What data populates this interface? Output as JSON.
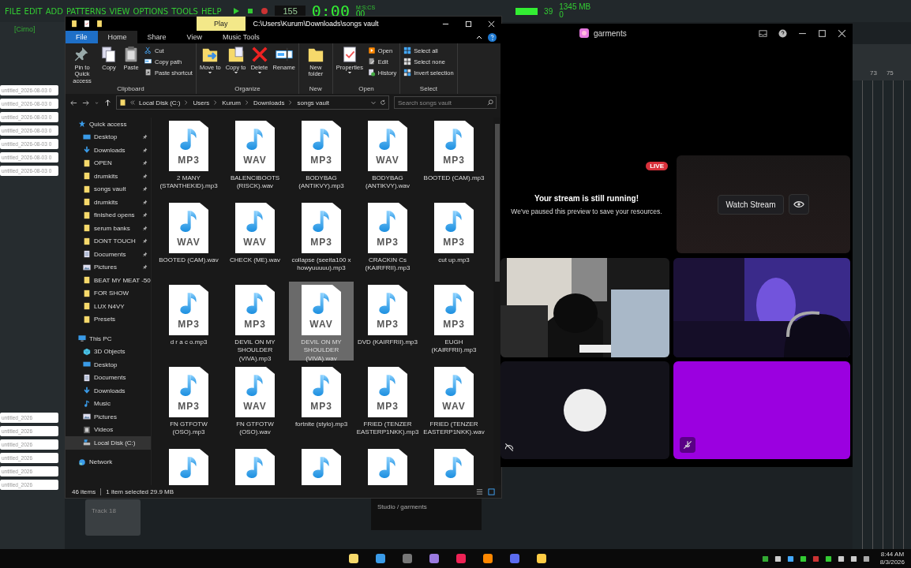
{
  "fl": {
    "menu": [
      "FILE",
      "EDIT",
      "ADD",
      "PATTERNS",
      "VIEW",
      "OPTIONS",
      "TOOLS",
      "HELP"
    ],
    "tempo": "155",
    "time": "0:00",
    "time_small": "00",
    "time_unit": "M:S:CS",
    "cpu": "39",
    "memory": "1345 MB",
    "polyphony": "0",
    "preset": "[Cirno]",
    "browser": [
      "untitled_2026-08-03 0",
      "untitled_2026-08-03 0",
      "untitled_2026-08-03 0",
      "untitled_2026-08-03 0",
      "untitled_2026-08-03 0",
      "untitled_2026-08-03 0",
      "untitled_2026-08-03 0"
    ],
    "browser_lower": [
      "untitled_2026",
      "untitled_2026",
      "untitled_2026",
      "untitled_2026",
      "untitled_2026",
      "untitled_2026"
    ],
    "track": "Track 18",
    "bars": [
      "73",
      "75"
    ]
  },
  "explorer": {
    "title": "C:\\Users\\Kurum\\Downloads\\songs vault",
    "context_tab": "Play",
    "tabs": [
      {
        "label": "File",
        "kind": "file",
        "selected": false
      },
      {
        "label": "Home",
        "kind": "tab",
        "selected": true
      },
      {
        "label": "Share",
        "kind": "tab",
        "selected": false
      },
      {
        "label": "View",
        "kind": "tab",
        "selected": false
      },
      {
        "label": "Music Tools",
        "kind": "tab",
        "selected": false
      }
    ],
    "groups": [
      {
        "name": "Clipboard",
        "large": [
          {
            "label": "Pin to Quick access",
            "kind": "pin",
            "dropdown": false
          },
          {
            "label": "Copy",
            "kind": "copy",
            "dropdown": false
          },
          {
            "label": "Paste",
            "kind": "paste",
            "dropdown": false
          }
        ],
        "small": [
          {
            "label": "Cut",
            "kind": "cut"
          },
          {
            "label": "Copy path",
            "kind": "path"
          },
          {
            "label": "Paste shortcut",
            "kind": "shortcut"
          }
        ]
      },
      {
        "name": "Organize",
        "large": [
          {
            "label": "Move to",
            "kind": "move",
            "dropdown": true
          },
          {
            "label": "Copy to",
            "kind": "copyto",
            "dropdown": true
          },
          {
            "label": "Delete",
            "kind": "delete",
            "dropdown": true
          },
          {
            "label": "Rename",
            "kind": "rename",
            "dropdown": false
          }
        ]
      },
      {
        "name": "New",
        "large": [
          {
            "label": "New folder",
            "kind": "newfolder",
            "dropdown": false
          }
        ]
      },
      {
        "name": "Open",
        "large": [
          {
            "label": "Properties",
            "kind": "properties",
            "dropdown": true
          }
        ],
        "small": [
          {
            "label": "Open",
            "kind": "open"
          },
          {
            "label": "Edit",
            "kind": "edit"
          },
          {
            "label": "History",
            "kind": "history"
          }
        ]
      },
      {
        "name": "Select",
        "small": [
          {
            "label": "Select all",
            "kind": "selectall"
          },
          {
            "label": "Select none",
            "kind": "selectnone"
          },
          {
            "label": "Invert selection",
            "kind": "invert"
          }
        ]
      }
    ],
    "crumbs": [
      "Local Disk (C:)",
      "Users",
      "Kurum",
      "Downloads",
      "songs vault"
    ],
    "search": {
      "placeholder": "Search songs vault"
    },
    "nav": [
      {
        "label": "Quick access",
        "kind": "star",
        "selected": false,
        "children": [
          {
            "label": "Desktop",
            "kind": "desktop",
            "pinned": true,
            "selected": false
          },
          {
            "label": "Downloads",
            "kind": "download",
            "pinned": true,
            "selected": false
          },
          {
            "label": "OPEN",
            "kind": "folder",
            "pinned": true,
            "selected": false
          },
          {
            "label": "drumkits",
            "kind": "folder",
            "pinned": true,
            "selected": false
          },
          {
            "label": "songs vault",
            "kind": "folder",
            "pinned": true,
            "selected": false
          },
          {
            "label": "drumkits",
            "kind": "folder",
            "pinned": true,
            "selected": false
          },
          {
            "label": "finished opens",
            "kind": "folder",
            "pinned": true,
            "selected": false
          },
          {
            "label": "serum banks",
            "kind": "folder",
            "pinned": true,
            "selected": false
          },
          {
            "label": "DONT TOUCH",
            "kind": "folder",
            "pinned": true,
            "selected": false
          },
          {
            "label": "Documents",
            "kind": "document",
            "pinned": true,
            "selected": false
          },
          {
            "label": "Pictures",
            "kind": "pictures",
            "pinned": true,
            "selected": false
          },
          {
            "label": "BEAT MY MEAT -50",
            "kind": "folder",
            "pinned": false,
            "selected": false
          },
          {
            "label": "FOR SHOW",
            "kind": "folder",
            "pinned": false,
            "selected": false
          },
          {
            "label": "LUX N4VY",
            "kind": "folder",
            "pinned": false,
            "selected": false
          },
          {
            "label": "Presets",
            "kind": "folder",
            "pinned": false,
            "selected": false
          }
        ]
      },
      {
        "label": "This PC",
        "kind": "pc",
        "selected": false,
        "children": [
          {
            "label": "3D Objects",
            "kind": "cube",
            "pinned": false,
            "selected": false
          },
          {
            "label": "Desktop",
            "kind": "desktop",
            "pinned": false,
            "selected": false
          },
          {
            "label": "Documents",
            "kind": "document",
            "pinned": false,
            "selected": false
          },
          {
            "label": "Downloads",
            "kind": "download",
            "pinned": false,
            "selected": false
          },
          {
            "label": "Music",
            "kind": "music",
            "pinned": false,
            "selected": false
          },
          {
            "label": "Pictures",
            "kind": "pictures",
            "pinned": false,
            "selected": false
          },
          {
            "label": "Videos",
            "kind": "video",
            "pinned": false,
            "selected": false
          },
          {
            "label": "Local Disk (C:)",
            "kind": "disk",
            "pinned": false,
            "selected": true
          }
        ]
      },
      {
        "label": "Network",
        "kind": "network",
        "selected": false
      }
    ],
    "files": [
      {
        "kind": "file",
        "type": "MP3",
        "name": "2 MANY (STANTHEKID).mp3",
        "selected": false
      },
      {
        "kind": "file",
        "type": "WAV",
        "name": "BALENCIBOOTS (RISCK).wav",
        "selected": false
      },
      {
        "kind": "file",
        "type": "MP3",
        "name": "BODYBAG (ANTIKVY).mp3",
        "selected": false
      },
      {
        "kind": "file",
        "type": "WAV",
        "name": "BODYBAG (ANTIKVY).wav",
        "selected": false
      },
      {
        "kind": "file",
        "type": "MP3",
        "name": "BOOTED (CAM).mp3",
        "selected": false
      },
      {
        "kind": "file",
        "type": "WAV",
        "name": "BOOTED (CAM).wav",
        "selected": false
      },
      {
        "kind": "file",
        "type": "WAV",
        "name": "CHECK (ME).wav",
        "selected": false
      },
      {
        "kind": "file",
        "type": "MP3",
        "name": "collapse (seeita100 x howyuuuuu).mp3",
        "selected": false
      },
      {
        "kind": "file",
        "type": "MP3",
        "name": "CRACKIN Cs (KAIRFRII).mp3",
        "selected": false
      },
      {
        "kind": "file",
        "type": "MP3",
        "name": "cut up.mp3",
        "selected": false
      },
      {
        "kind": "file",
        "type": "MP3",
        "name": "d r a c o.mp3",
        "selected": false
      },
      {
        "kind": "file",
        "type": "MP3",
        "name": "DEVIL ON MY SHOULDER (VIVA).mp3",
        "selected": false
      },
      {
        "kind": "file",
        "type": "WAV",
        "name": "DEVIL ON MY SHOULDER (VIVA).wav",
        "selected": true
      },
      {
        "kind": "file",
        "type": "MP3",
        "name": "DVD (KAIRFRII).mp3",
        "selected": false
      },
      {
        "kind": "file",
        "type": "MP3",
        "name": "EUGH (KAIRFRII).mp3",
        "selected": false
      },
      {
        "kind": "file",
        "type": "MP3",
        "name": "FN GTFOTW (OSO).mp3",
        "selected": false
      },
      {
        "kind": "file",
        "type": "WAV",
        "name": "FN GTFOTW (OSO).wav",
        "selected": false
      },
      {
        "kind": "file",
        "type": "MP3",
        "name": "fortnite (stylo).mp3",
        "selected": false
      },
      {
        "kind": "file",
        "type": "MP3",
        "name": "FRIED (TENZER EASTERP1NKK).mp3",
        "selected": false
      },
      {
        "kind": "file",
        "type": "WAV",
        "name": "FRIED (TENZER EASTERP1NKK).wav",
        "selected": false
      },
      {
        "kind": "cut",
        "selected": false
      },
      {
        "kind": "cut",
        "selected": false
      },
      {
        "kind": "cut",
        "selected": false
      },
      {
        "kind": "cut",
        "selected": false
      },
      {
        "kind": "cut",
        "selected": false
      }
    ],
    "status": [
      "46 items",
      "1 item selected  29.9 MB"
    ]
  },
  "discord": {
    "title": "garments",
    "live": "LIVE",
    "heading": "Your stream is still running!",
    "subtext": "We've paused this preview to save your resources.",
    "watch": "Watch Stream",
    "tiles": [
      {
        "kind": "video"
      },
      {
        "kind": "video_dark"
      },
      {
        "kind": "avatar"
      },
      {
        "kind": "color",
        "color": "#9b00e0"
      }
    ],
    "voice_channel": "Studio / garments"
  },
  "taskbar": {
    "time": "8:44 AM",
    "date": "8/3/2026"
  }
}
